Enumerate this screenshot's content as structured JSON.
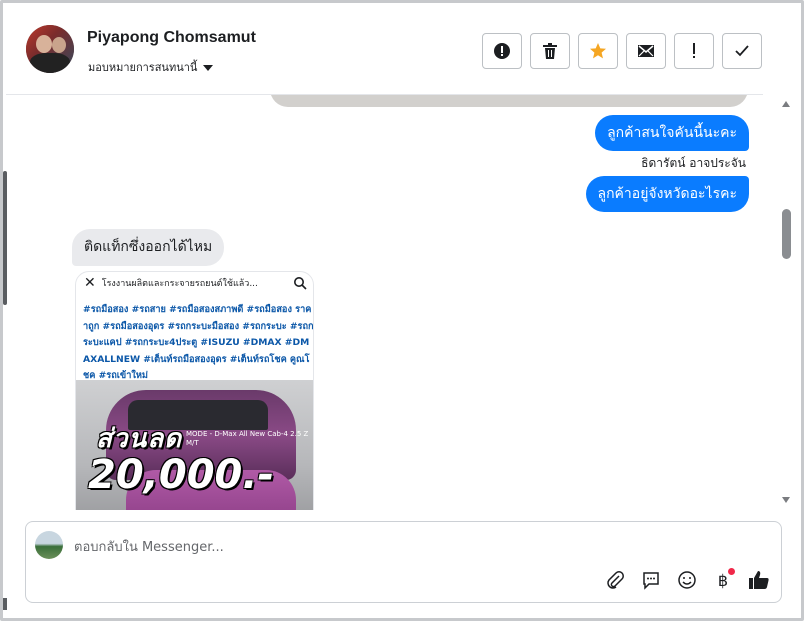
{
  "header": {
    "name": "Piyapong Chomsamut",
    "assign_label": "มอบหมายการสนทนานี้"
  },
  "actions": [
    "alert-circle-icon",
    "trash-icon",
    "star-icon",
    "mail-icon",
    "exclamation-icon",
    "check-icon"
  ],
  "thread": {
    "outgoing_1": "ลูกค้าสนใจคันนี้นะคะ",
    "sender_name": "ธิดารัตน์ อาจประจัน",
    "outgoing_2": "ลูกค้าอยู่จังหวัดอะไรคะ",
    "incoming_1": "ติดแท็กซึ่งออกได้ไหม"
  },
  "post": {
    "title": "โรงงานผลิตและกระจายรถยนต์ใช้แล้ว...",
    "hashtags": "#รถมือสอง #รถสาย #รถมือสองสภาพดี #รถมือสอง ราคาถูก #รถมือสองอุดร #รถกระบะมือสอง #รถกระบะ #รถกระบะแคป #รถกระบะ4ประตู #ISUZU #DMAX #DMAXALLNEW #เต็นท์รถมือสองอุดร #เต็นท์รถโชค คูณโชค #รถเข้าใหม่",
    "photo_big_1": "ส่วนลด",
    "photo_big_2": "20,000.-",
    "photo_small": "MODE - D-Max All New Cab-4 2.5 Z M/T"
  },
  "composer": {
    "placeholder": "ตอบกลับใน Messenger..."
  },
  "colors": {
    "accent": "#0a7cff",
    "incoming_bubble": "#e9eaed",
    "star": "#f5a623",
    "notification": "#f02849"
  }
}
